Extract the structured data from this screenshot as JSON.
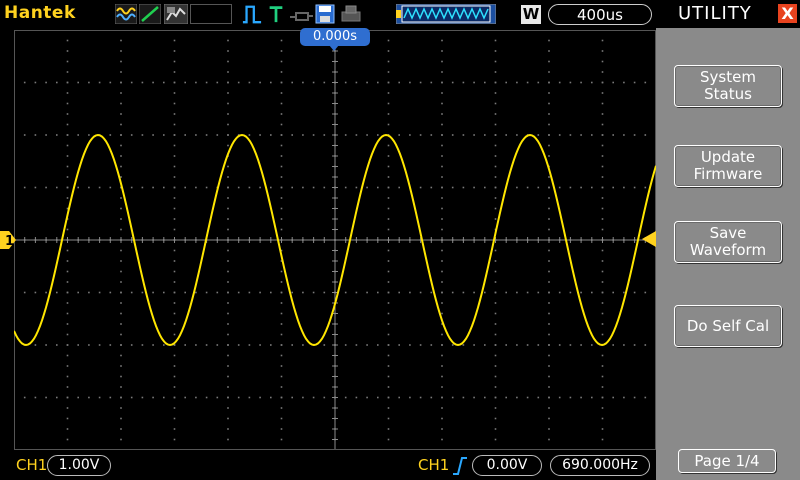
{
  "header": {
    "brand": "Hantek",
    "timebase": "400us",
    "window_badge": "W",
    "time_offset": "0.000s"
  },
  "channel": {
    "label": "CH1",
    "scale": "1.00V",
    "marker": "1",
    "color": "#ffd21f"
  },
  "trigger": {
    "source": "CH1",
    "level": "0.00V",
    "frequency": "690.000Hz"
  },
  "panel": {
    "title": "UTILITY",
    "close_label": "X",
    "buttons": [
      {
        "line1": "System",
        "line2": "Status"
      },
      {
        "line1": "Update",
        "line2": "Firmware"
      },
      {
        "line1": "Save",
        "line2": "Waveform"
      },
      {
        "line1": "Do Self Cal",
        "line2": ""
      }
    ],
    "page_label": "Page 1/4"
  },
  "colors": {
    "waveform": "#ffe600",
    "accent_blue": "#2f6ed0",
    "trigger_green": "#20d080",
    "close_red": "#e8431f",
    "panel_gray": "#8a8a8a"
  },
  "icons": [
    "wave-icon",
    "ramp-icon",
    "grid-icon",
    "pulse-edge-icon",
    "trigger-t-icon",
    "probe-icon",
    "floppy-icon",
    "printer-icon",
    "waveform-window-icon"
  ]
}
